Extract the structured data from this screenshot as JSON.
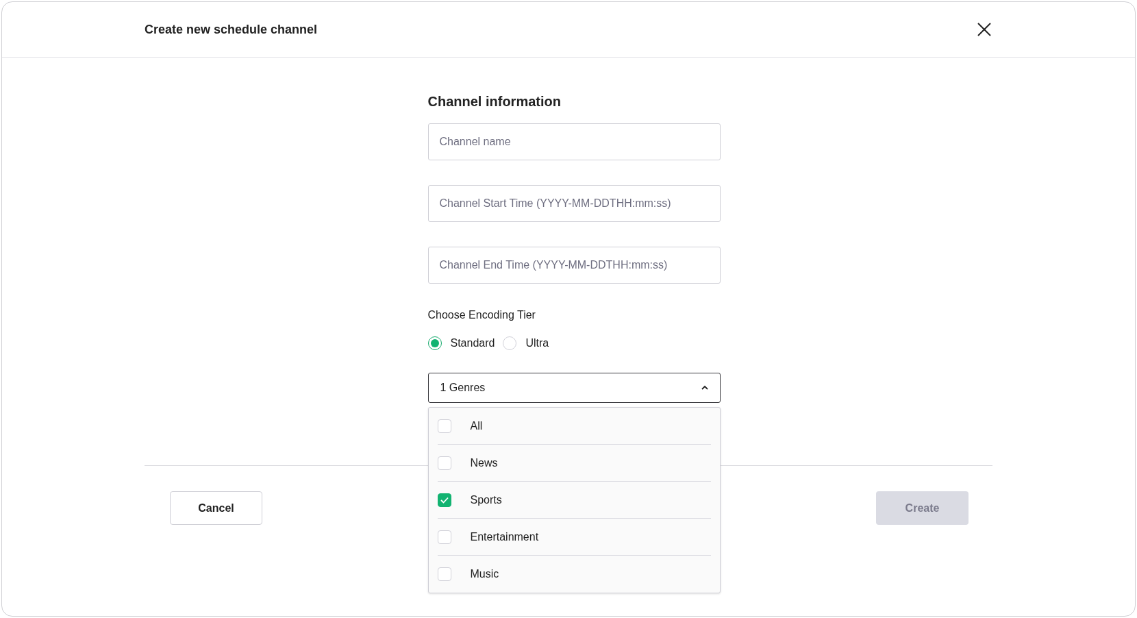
{
  "dialog": {
    "title": "Create new schedule channel"
  },
  "section_title": "Channel information",
  "fields": [
    {
      "placeholder": "Channel name"
    },
    {
      "placeholder": "Channel Start Time (YYYY-MM-DDTHH:mm:ss)"
    },
    {
      "placeholder": "Channel End Time (YYYY-MM-DDTHH:mm:ss)"
    }
  ],
  "encoding_tier": {
    "label": "Choose Encoding Tier",
    "options": [
      {
        "label": "Standard",
        "selected": true
      },
      {
        "label": "Ultra",
        "selected": false
      }
    ]
  },
  "genres_select": {
    "value": "1 Genres",
    "expanded": true,
    "options": [
      {
        "label": "All",
        "checked": false
      },
      {
        "label": "News",
        "checked": false
      },
      {
        "label": "Sports",
        "checked": true
      },
      {
        "label": "Entertainment",
        "checked": false
      },
      {
        "label": "Music",
        "checked": false
      }
    ]
  },
  "buttons": [
    {
      "label": "Cancel",
      "kind": "secondary",
      "disabled": false
    },
    {
      "label": "Create",
      "kind": "primary",
      "disabled": true
    }
  ]
}
